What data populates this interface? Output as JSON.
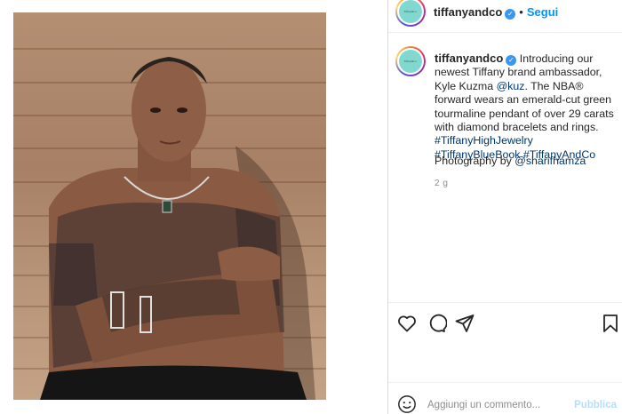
{
  "post": {
    "username": "tiffanyandco",
    "follow_label": "Segui",
    "dot": "•",
    "avatar_text": "Tiffany&Co.",
    "caption": {
      "intro": "Introducing our newest Tiffany brand ambassador, Kyle Kuzma ",
      "mention": "@kuz",
      "body": ". The NBA® forward wears an emerald-cut green tourmaline pendant of over 29 carats with diamond bracelets and rings. ",
      "hashtags": [
        "#TiffanyHighJewelry",
        "#TiffanyBlueBook",
        "#TiffanyAndCo"
      ],
      "photo_credit_prefix": "Photography by ",
      "photo_credit_handle": "@sharifhamza"
    },
    "time_ago": "2 g"
  },
  "actions": {
    "like": "heart-icon",
    "comment": "comment-icon",
    "share": "share-icon",
    "save": "bookmark-icon"
  },
  "comment_box": {
    "placeholder": "Aggiungi un commento...",
    "publish_label": "Pubblica",
    "emoji": "smiley-icon"
  },
  "colors": {
    "link_blue": "#0095f6",
    "hashtag_blue": "#00376b",
    "tiffany_blue": "#81d8d0",
    "publish_disabled": "#b2dffc"
  }
}
